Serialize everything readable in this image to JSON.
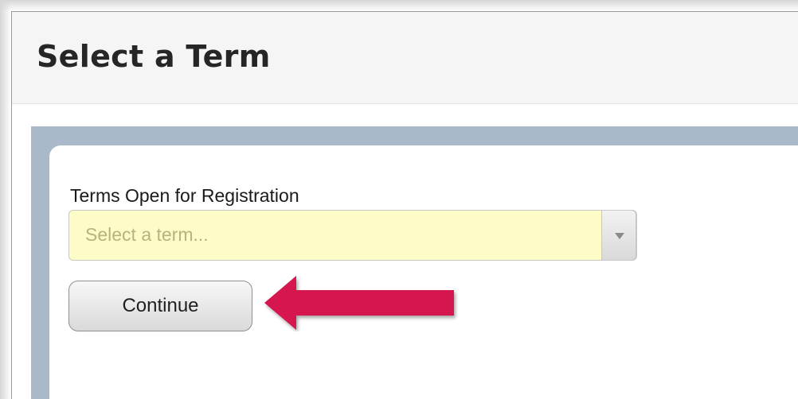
{
  "page": {
    "title": "Select a Term"
  },
  "form": {
    "label": "Terms Open for Registration",
    "term_select": {
      "placeholder": "Select a term...",
      "value": ""
    },
    "continue_label": "Continue"
  },
  "annotation": {
    "icon": "left-arrow-icon",
    "color": "#d6154f"
  },
  "colors": {
    "header_bg": "#f5f5f5",
    "content_border": "#a9b9c9",
    "select_highlight": "#fdfbc8"
  }
}
